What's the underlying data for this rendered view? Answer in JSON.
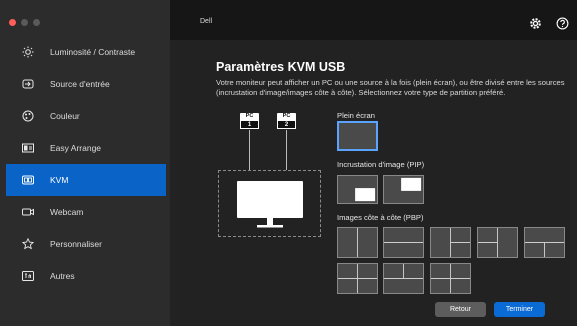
{
  "app": {
    "brand": "Dell"
  },
  "sidebar": {
    "items": [
      {
        "label": "Luminosité / Contraste",
        "icon": "brightness-icon",
        "active": false
      },
      {
        "label": "Source d'entrée",
        "icon": "input-source-icon",
        "active": false
      },
      {
        "label": "Couleur",
        "icon": "color-icon",
        "active": false
      },
      {
        "label": "Easy Arrange",
        "icon": "easy-arrange-icon",
        "active": false
      },
      {
        "label": "KVM",
        "icon": "kvm-icon",
        "active": true
      },
      {
        "label": "Webcam",
        "icon": "webcam-icon",
        "active": false
      },
      {
        "label": "Personnaliser",
        "icon": "star-icon",
        "active": false
      },
      {
        "label": "Autres",
        "icon": "others-icon",
        "active": false
      }
    ]
  },
  "main": {
    "title": "Paramètres KVM USB",
    "description": "Votre moniteur peut afficher un PC ou une source à la fois (plein écran), ou être divisé entre les sources (incrustation d'image/images côte à côte). Sélectionnez votre type de partition préféré.",
    "diagram": {
      "pcs": [
        {
          "label": "PC",
          "number": "1"
        },
        {
          "label": "PC",
          "number": "2"
        }
      ]
    },
    "sections": {
      "fullscreen": "Plein écran",
      "pip": "Incrustation d'image (PIP)",
      "pbp": "Images côte à côte (PBP)"
    },
    "selected_option": "fullscreen",
    "buttons": {
      "back": "Retour",
      "done": "Terminer"
    }
  },
  "colors": {
    "accent": "#0a63c7",
    "selected_border": "#5aa3ff"
  }
}
